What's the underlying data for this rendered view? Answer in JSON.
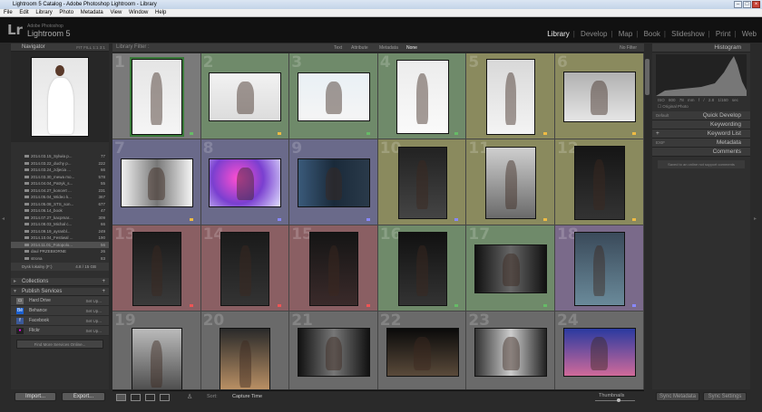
{
  "window": {
    "title": "Lightroom 5 Catalog - Adobe Photoshop Lightroom - Library"
  },
  "menu": [
    "File",
    "Edit",
    "Library",
    "Photo",
    "Metadata",
    "View",
    "Window",
    "Help"
  ],
  "identity": {
    "logo": "Lr",
    "brand_top": "Adobe Photoshop",
    "brand": "Lightroom 5"
  },
  "modules": [
    "Library",
    "Develop",
    "Map",
    "Book",
    "Slideshow",
    "Print",
    "Web"
  ],
  "navigator": {
    "title": "Navigator",
    "options": "FIT  FILL  1:1  3:1"
  },
  "folders": [
    {
      "name": "2014.03.15_Sylwia p...",
      "count": "77"
    },
    {
      "name": "2014.03.22_duchy p...",
      "count": "222"
    },
    {
      "name": "2014.03.24_zdjecia ...",
      "count": "66"
    },
    {
      "name": "2014.03.30_mewa mo...",
      "count": "578"
    },
    {
      "name": "2014.04.04_Patryk_s...",
      "count": "55"
    },
    {
      "name": "2014.04.27_koncert ...",
      "count": "231"
    },
    {
      "name": "2014.05.04_Wideo k...",
      "count": "367"
    },
    {
      "name": "2014.05.08_STS_son...",
      "count": "677"
    },
    {
      "name": "2014.06.14_book",
      "count": "47"
    },
    {
      "name": "2014.07.27_kacpmar...",
      "count": "309"
    },
    {
      "name": "2014.08.03_Michal c...",
      "count": "66"
    },
    {
      "name": "2014.09.19_ayranbl...",
      "count": "249"
    },
    {
      "name": "2014.10.04_Festiwal ...",
      "count": "190"
    },
    {
      "name": "2014.11.01_Fotopolo...",
      "count": "56"
    },
    {
      "name": "daul PRZEBIORNE",
      "count": "26"
    },
    {
      "name": "strona",
      "count": "83"
    }
  ],
  "disk": {
    "label": "Dysk lokalny (F:)",
    "value": "4.8 / 15 GB"
  },
  "collections": "Collections",
  "publish": {
    "title": "Publish Services",
    "services": [
      {
        "icon": "hard-drive",
        "label": "Hard Drive",
        "setup": "Set Up..."
      },
      {
        "icon": "behance",
        "label": "Behance",
        "setup": "Set Up..."
      },
      {
        "icon": "facebook",
        "label": "Facebook",
        "setup": "Set Up..."
      },
      {
        "icon": "flickr",
        "label": "Flickr",
        "setup": "Set Up..."
      }
    ],
    "find_more": "Find More Services Online..."
  },
  "left_buttons": {
    "import": "Import...",
    "export": "Export..."
  },
  "filter": {
    "label": "Library Filter :",
    "tabs": [
      "Text",
      "Attribute",
      "Metadata",
      "None"
    ],
    "preset": "No Filter"
  },
  "grid_numbers": [
    "1",
    "2",
    "3",
    "4",
    "5",
    "6",
    "7",
    "8",
    "9",
    "10",
    "11",
    "12",
    "13",
    "14",
    "15",
    "16",
    "17",
    "18",
    "19",
    "20",
    "21",
    "22",
    "23",
    "24"
  ],
  "grid_colors": [
    "#7a7a7a",
    "#6f8a6a",
    "#6f8a6a",
    "#6f8a6a",
    "#8a8a5e",
    "#8a8a5e",
    "#6a6a8a",
    "#6a6a8a",
    "#6a6a8a",
    "#8a8a5e",
    "#8a8a5e",
    "#8a8a5e",
    "#8a5f63",
    "#8a5f63",
    "#8a5f63",
    "#6f8a6a",
    "#6f8a6a",
    "#7a6a8a",
    "#6a6a6a",
    "#6a6a6a",
    "#6a6a6a",
    "#6a6a6a",
    "#6a6a6a",
    "#6a6a6a"
  ],
  "toolbar": {
    "sort_label": "Sort:",
    "sort_value": "Capture Time",
    "thumbnails": "Thumbnails"
  },
  "histogram": {
    "title": "Histogram",
    "info": [
      "ISO 800",
      "78 mm",
      "f / 2.8",
      "1/160 sec"
    ],
    "original_photo": "Original Photo"
  },
  "quick_develop": {
    "preset": "Default",
    "title": "Quick Develop"
  },
  "keywording": "Keywording",
  "keyword_list": "Keyword List",
  "metadata": {
    "preset": "EXIF",
    "title": "Metadata"
  },
  "comments": {
    "title": "Comments",
    "note": "Saved to an online not support comments"
  },
  "right_buttons": {
    "sync_metadata": "Sync Metadata",
    "sync_settings": "Sync Settings"
  }
}
